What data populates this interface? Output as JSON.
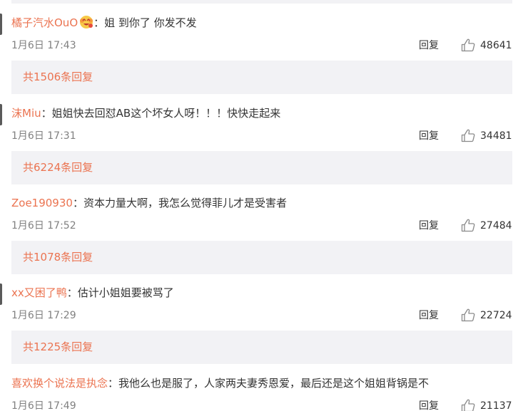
{
  "comments": [
    {
      "username": "橘子汽水OuO",
      "has_badge": true,
      "colon": "：",
      "text": "姐 到你了 你发不发",
      "date": "1月6日 17:43",
      "reply_label": "回复",
      "likes": "48641",
      "replies_text": "共1506条回复"
    },
    {
      "username": "沫Miu",
      "has_badge": false,
      "colon": "：",
      "text": "姐姐快去回怼AB这个坏女人呀！！！快快走起来",
      "date": "1月6日 17:31",
      "reply_label": "回复",
      "likes": "34481",
      "replies_text": "共6224条回复"
    },
    {
      "username": "Zoe190930",
      "has_badge": false,
      "colon": "：",
      "text": "资本力量大啊，我怎么觉得菲儿才是受害者",
      "date": "1月6日 17:52",
      "reply_label": "回复",
      "likes": "27484",
      "replies_text": "共1078条回复"
    },
    {
      "username": "xx又困了鸭",
      "has_badge": false,
      "colon": "：",
      "text": "估计小姐姐要被骂了",
      "date": "1月6日 17:29",
      "reply_label": "回复",
      "likes": "22724",
      "replies_text": "共1225条回复"
    },
    {
      "username": "喜欢换个说法是执念",
      "has_badge": false,
      "colon": "：",
      "text": "我他么也是服了，人家两夫妻秀恩爱，最后还是这个姐姐背锅是不",
      "date": "1月6日 17:49",
      "reply_label": "回复",
      "likes": "21137",
      "replies_text": ""
    }
  ],
  "colors": {
    "username": "#eb7350",
    "body_text": "#333333",
    "meta_text": "#808080",
    "reply_box_bg": "#f2f2f5"
  },
  "icons": {
    "like": "thumbs-up-icon",
    "badge": "emoji-badge-icon"
  }
}
